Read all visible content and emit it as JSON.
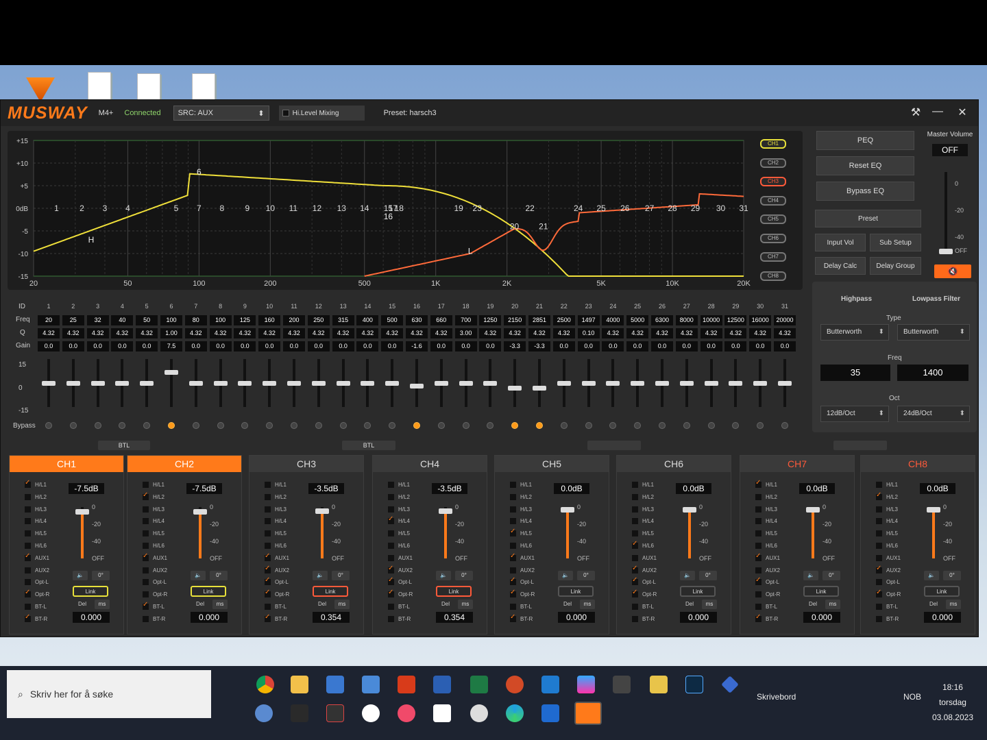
{
  "app": {
    "logo": "MUSWAY",
    "model": "M4+",
    "status": "Connected",
    "src_label": "SRC: AUX",
    "hilevel_label": "Hi.Level Mixing",
    "preset_label": "Preset: harsch3"
  },
  "graph": {
    "y_labels": [
      "+15",
      "+10",
      "+5",
      "0dB",
      "-5",
      "-10",
      "-15"
    ],
    "x_labels": [
      "20",
      "50",
      "100",
      "200",
      "500",
      "1K",
      "2K",
      "5K",
      "10K",
      "20K"
    ],
    "band_numbers": [
      "1",
      "2",
      "3",
      "4",
      "5",
      "7",
      "8",
      "9",
      "10",
      "11",
      "12",
      "13",
      "14",
      "15",
      "17",
      "18",
      "19",
      "23",
      "22",
      "20",
      "21",
      "24",
      "25",
      "26",
      "27",
      "28",
      "29",
      "30",
      "31"
    ],
    "markers": {
      "hp": "H",
      "lp": "L",
      "peak": "6",
      "dip": "16"
    }
  },
  "channel_selector": [
    "CH1",
    "CH2",
    "CH3",
    "CH4",
    "CH5",
    "CH6",
    "CH7",
    "CH8"
  ],
  "right_buttons": [
    "PEQ",
    "Reset EQ",
    "Bypass EQ"
  ],
  "preset_buttons": {
    "preset": "Preset",
    "input_vol": "Input Vol",
    "sub_setup": "Sub Setup",
    "delay_calc": "Delay Calc",
    "delay_group": "Delay Group"
  },
  "master": {
    "title": "Master Volume",
    "value": "OFF",
    "scale": [
      "0",
      "-20",
      "-40",
      "OFF"
    ],
    "mute_icon": "🔇"
  },
  "filter": {
    "highpass": "Highpass",
    "lowpass": "Lowpass Filter",
    "type_label": "Type",
    "hp_type": "Butterworth",
    "lp_type": "Butterworth",
    "freq_label": "Freq",
    "hp_freq": "35",
    "lp_freq": "1400",
    "oct_label": "Oct",
    "hp_oct": "12dB/Oct",
    "lp_oct": "24dB/Oct"
  },
  "eq_table": {
    "row_labels": {
      "id": "ID",
      "freq": "Freq",
      "q": "Q",
      "gain": "Gain",
      "bypass": "Bypass"
    },
    "fader_scale": [
      "15",
      "0",
      "-15"
    ],
    "ids": [
      "1",
      "2",
      "3",
      "4",
      "5",
      "6",
      "7",
      "8",
      "9",
      "10",
      "11",
      "12",
      "13",
      "14",
      "15",
      "16",
      "17",
      "18",
      "19",
      "20",
      "21",
      "22",
      "23",
      "24",
      "25",
      "26",
      "27",
      "28",
      "29",
      "30",
      "31"
    ],
    "freq": [
      "20",
      "25",
      "32",
      "40",
      "50",
      "100",
      "80",
      "100",
      "125",
      "160",
      "200",
      "250",
      "315",
      "400",
      "500",
      "630",
      "660",
      "700",
      "1250",
      "2150",
      "2851",
      "2500",
      "1497",
      "4000",
      "5000",
      "6300",
      "8000",
      "10000",
      "12500",
      "16000",
      "20000"
    ],
    "q": [
      "4.32",
      "4.32",
      "4.32",
      "4.32",
      "4.32",
      "1.00",
      "4.32",
      "4.32",
      "4.32",
      "4.32",
      "4.32",
      "4.32",
      "4.32",
      "4.32",
      "4.32",
      "4.32",
      "4.32",
      "3.00",
      "4.32",
      "4.32",
      "4.32",
      "4.32",
      "0.10",
      "4.32",
      "4.32",
      "4.32",
      "4.32",
      "4.32",
      "4.32",
      "4.32",
      "4.32"
    ],
    "gain": [
      "0.0",
      "0.0",
      "0.0",
      "0.0",
      "0.0",
      "7.5",
      "0.0",
      "0.0",
      "0.0",
      "0.0",
      "0.0",
      "0.0",
      "0.0",
      "0.0",
      "0.0",
      "-1.6",
      "0.0",
      "0.0",
      "0.0",
      "-3.3",
      "-3.3",
      "0.0",
      "0.0",
      "0.0",
      "0.0",
      "0.0",
      "0.0",
      "0.0",
      "0.0",
      "0.0",
      "0.0"
    ],
    "bypass_on": [
      6,
      16,
      20,
      21
    ]
  },
  "btl": [
    "BTL",
    "BTL"
  ],
  "channels": [
    {
      "name": "CH1",
      "gain": "-7.5dB",
      "delay": "0.000",
      "active": true,
      "red": false,
      "link": "y",
      "level": 0.3,
      "on": [
        1,
        7,
        10,
        12,
        13
      ]
    },
    {
      "name": "CH2",
      "gain": "-7.5dB",
      "delay": "0.000",
      "active": true,
      "red": false,
      "link": "y",
      "level": 0.3,
      "on": [
        2,
        7,
        11,
        13,
        14
      ]
    },
    {
      "name": "CH3",
      "gain": "-3.5dB",
      "delay": "0.354",
      "active": false,
      "red": false,
      "link": "r",
      "level": 0.15,
      "on": [
        7,
        8,
        9,
        10,
        12
      ]
    },
    {
      "name": "CH4",
      "gain": "-3.5dB",
      "delay": "0.354",
      "active": false,
      "red": false,
      "link": "r",
      "level": 0.15,
      "on": [
        4,
        8,
        9,
        10,
        13
      ]
    },
    {
      "name": "CH5",
      "gain": "0.0dB",
      "delay": "0.000",
      "active": false,
      "red": false,
      "link": "",
      "level": 0,
      "on": [
        5,
        7,
        9,
        10,
        12
      ]
    },
    {
      "name": "CH6",
      "gain": "0.0dB",
      "delay": "0.000",
      "active": false,
      "red": false,
      "link": "",
      "level": 0,
      "on": [
        6,
        8,
        9,
        10,
        13
      ]
    },
    {
      "name": "CH7",
      "gain": "0.0dB",
      "delay": "0.000",
      "active": false,
      "red": true,
      "link": "",
      "level": 0,
      "on": [
        1,
        7,
        9,
        12
      ]
    },
    {
      "name": "CH8",
      "gain": "0.0dB",
      "delay": "0.000",
      "active": false,
      "red": true,
      "link": "",
      "level": 0,
      "on": [
        2,
        8,
        10,
        13
      ]
    }
  ],
  "io_labels": [
    "H/L1",
    "H/L2",
    "H/L3",
    "H/L4",
    "H/L5",
    "H/L6",
    "AUX1",
    "AUX2",
    "Opt-L",
    "Opt-R",
    "BT-L",
    "BT-R"
  ],
  "strip_labels": {
    "link": "Link",
    "del": "Del",
    "ms": "ms",
    "phase": "0°",
    "scale": [
      "0",
      "-20",
      "-40",
      "OFF"
    ]
  },
  "taskbar": {
    "search_placeholder": "Skriv her for å søke",
    "desktop": "Skrivebord",
    "lang": "NOB",
    "time": "18:16",
    "day": "torsdag",
    "date": "03.08.2023"
  }
}
